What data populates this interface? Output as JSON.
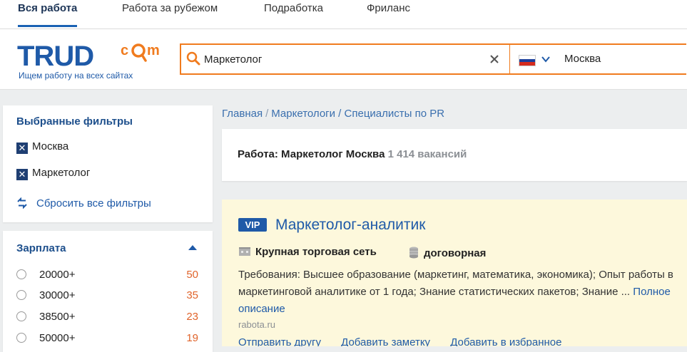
{
  "top_nav": {
    "tabs": [
      {
        "label": "Вся работа",
        "active": true
      },
      {
        "label": "Работа за рубежом",
        "active": false
      },
      {
        "label": "Подработка",
        "active": false
      },
      {
        "label": "Фриланс",
        "active": false
      }
    ]
  },
  "header": {
    "logo_text": "TRUD",
    "logo_suffix": "com",
    "tagline": "Ищем работу на всех сайтах",
    "search": {
      "value": "Маркетолог",
      "placeholder": ""
    },
    "country_flag": "russia-flag",
    "city": "Москва"
  },
  "filters": {
    "title": "Выбранные фильтры",
    "chips": [
      "Москва",
      "Маркетолог"
    ],
    "reset_label": "Сбросить все фильтры"
  },
  "salary": {
    "title": "Зарплата",
    "options": [
      {
        "label": "20000+",
        "count": "50"
      },
      {
        "label": "30000+",
        "count": "35"
      },
      {
        "label": "38500+",
        "count": "23"
      },
      {
        "label": "50000+",
        "count": "19"
      }
    ]
  },
  "breadcrumb": {
    "home": "Главная",
    "sep": "/",
    "path": "Маркетологи / Специалисты по PR"
  },
  "summary": {
    "title": "Работа: Маркетолог Москва",
    "count": "1 414 вакансий"
  },
  "vacancy": {
    "badge": "VIP",
    "title": "Маркетолог-аналитик",
    "company": "Крупная торговая сеть",
    "salary": "договорная",
    "description": "Требования: Высшее образование (маркетинг, математика, экономика); Опыт работы в маркетинговой аналитике от 1 года; Знание статистических пакетов; Знание ...",
    "more_link": "Полное описание",
    "source": "rabota.ru",
    "actions": [
      "Отправить другу",
      "Добавить заметку",
      "Добавить в избранное"
    ]
  },
  "colors": {
    "brand_blue": "#1f5aa8",
    "accent_orange": "#f07b1e",
    "vip_bg": "#fdf8dc",
    "count_orange": "#e0642b"
  }
}
